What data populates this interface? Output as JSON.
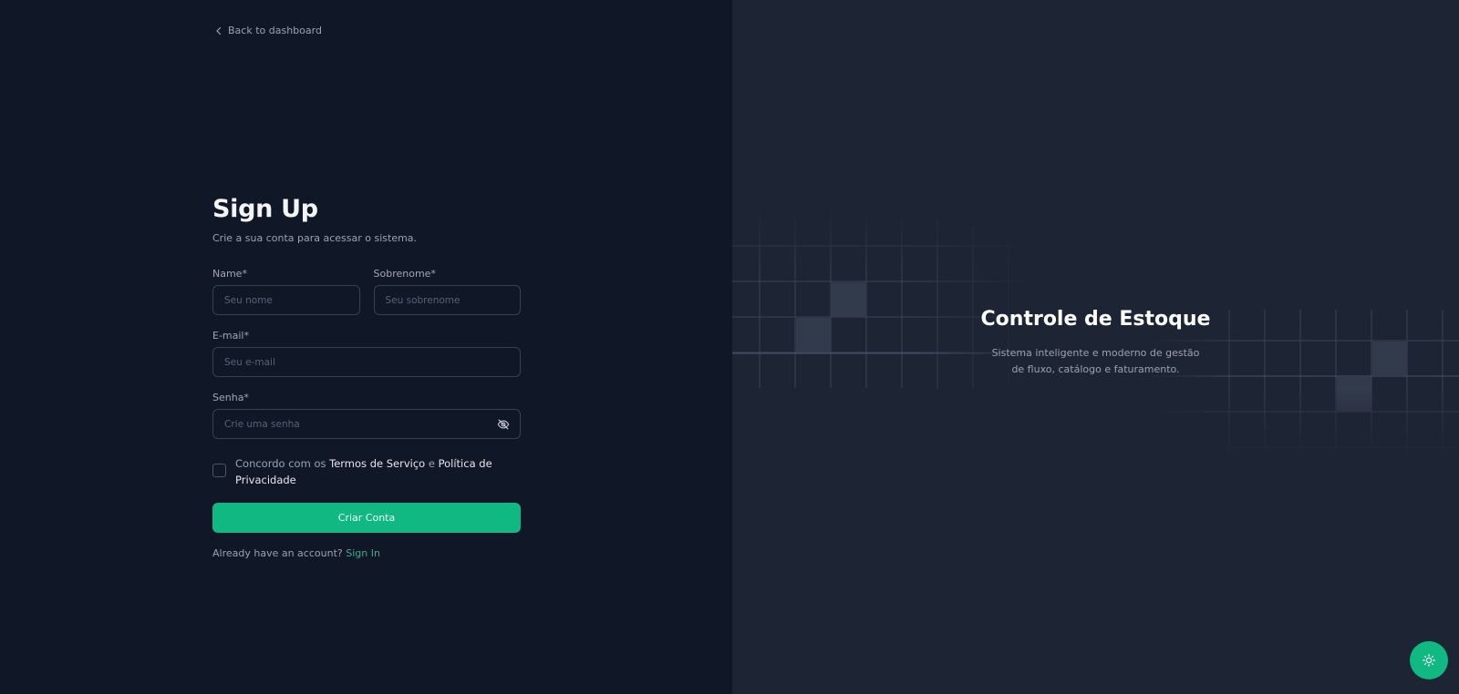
{
  "nav": {
    "back_label": "Back to dashboard"
  },
  "form": {
    "title": "Sign Up",
    "subtitle": "Crie a sua conta para acessar o sistema.",
    "first_name": {
      "label": "Name*",
      "placeholder": "Seu nome",
      "value": ""
    },
    "last_name": {
      "label": "Sobrenome*",
      "placeholder": "Seu sobrenome",
      "value": ""
    },
    "email": {
      "label": "E-mail*",
      "placeholder": "Seu e-mail",
      "value": ""
    },
    "password": {
      "label": "Senha*",
      "placeholder": "Crie uma senha",
      "value": "",
      "toggle_icon": "eye-off-icon"
    },
    "terms": {
      "checked": false,
      "prefix": "Concordo com os ",
      "terms_link": "Termos de Serviço",
      "joiner": " e ",
      "privacy_link": "Política de Privacidade"
    },
    "submit_label": "Criar Conta",
    "signin_prompt": "Already have an account?",
    "signin_link": "Sign In"
  },
  "hero": {
    "title": "Controle de Estoque",
    "subtitle": "Sistema inteligente e moderno de gestão de fluxo, catálogo e faturamento."
  },
  "theme_toggle": {
    "icon": "sun-icon"
  },
  "colors": {
    "accent": "#10b981",
    "left_bg": "#101828",
    "right_bg": "#1d2433"
  }
}
